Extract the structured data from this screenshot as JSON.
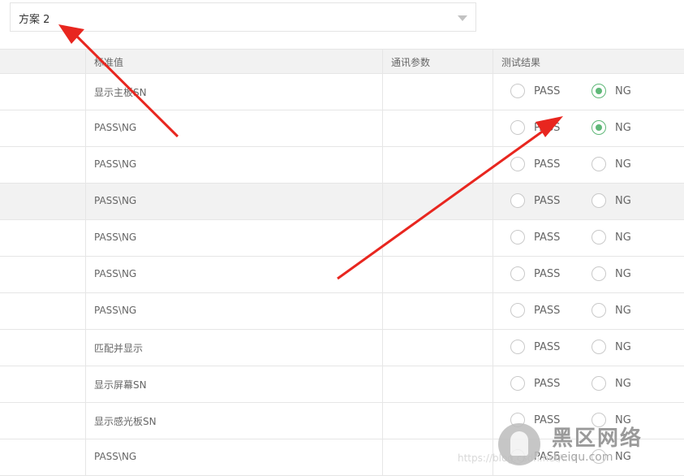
{
  "scheme_select": {
    "value": "方案 2"
  },
  "table": {
    "columns": [
      "",
      "标准值",
      "通讯参数",
      "测试结果"
    ],
    "pass_label": "PASS",
    "ng_label": "NG",
    "rows": [
      {
        "standard": "显示主板SN",
        "comm": "",
        "result": "NG"
      },
      {
        "standard": "PASS\\NG",
        "comm": "",
        "result": "NG"
      },
      {
        "standard": "PASS\\NG",
        "comm": "",
        "result": ""
      },
      {
        "standard": "PASS\\NG",
        "comm": "",
        "result": ""
      },
      {
        "standard": "PASS\\NG",
        "comm": "",
        "result": ""
      },
      {
        "standard": "PASS\\NG",
        "comm": "",
        "result": ""
      },
      {
        "standard": "PASS\\NG",
        "comm": "",
        "result": ""
      },
      {
        "standard": "匹配并显示",
        "comm": "",
        "result": ""
      },
      {
        "standard": "显示屏幕SN",
        "comm": "",
        "result": ""
      },
      {
        "standard": "显示感光板SN",
        "comm": "",
        "result": ""
      },
      {
        "standard": "PASS\\NG",
        "comm": "",
        "result": ""
      }
    ]
  },
  "watermark": {
    "title": "黑区网络",
    "site": "heiqu.com",
    "blog_tail": "https://blog.csdn.net/...3"
  },
  "colors": {
    "checked": "#5fb878",
    "arrow": "#e8261f",
    "header_bg": "#f2f2f2"
  }
}
